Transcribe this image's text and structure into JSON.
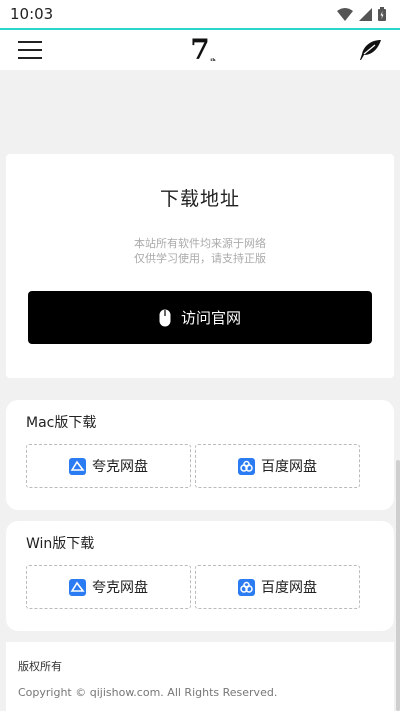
{
  "status_bar": {
    "time": "10:03",
    "icons": [
      "wifi-icon",
      "signal-icon",
      "battery-icon"
    ]
  },
  "header": {
    "logo_text": "7",
    "logo_small": "ᵢₕ",
    "menu_icon": "hamburger-icon",
    "action_icon": "feather-icon",
    "accent_color": "#29d6c9"
  },
  "main": {
    "title": "下载地址",
    "note_line1": "本站所有软件均来源于网络",
    "note_line2": "仅供学习使用，请支持正版",
    "visit_label": "访问官网",
    "visit_icon": "mouse-icon"
  },
  "sections": [
    {
      "title": "Mac版下载",
      "buttons": [
        {
          "label": "夸克网盘",
          "icon": "quark-cloud-icon"
        },
        {
          "label": "百度网盘",
          "icon": "baidu-cloud-icon"
        }
      ]
    },
    {
      "title": "Win版下载",
      "buttons": [
        {
          "label": "夸克网盘",
          "icon": "quark-cloud-icon"
        },
        {
          "label": "百度网盘",
          "icon": "baidu-cloud-icon"
        }
      ]
    }
  ],
  "footer": {
    "title": "版权所有",
    "copyright": "Copyright © qijishow.com. All Rights Reserved."
  },
  "colors": {
    "cloud_blue": "#2b7bf3",
    "button_black": "#000000"
  }
}
